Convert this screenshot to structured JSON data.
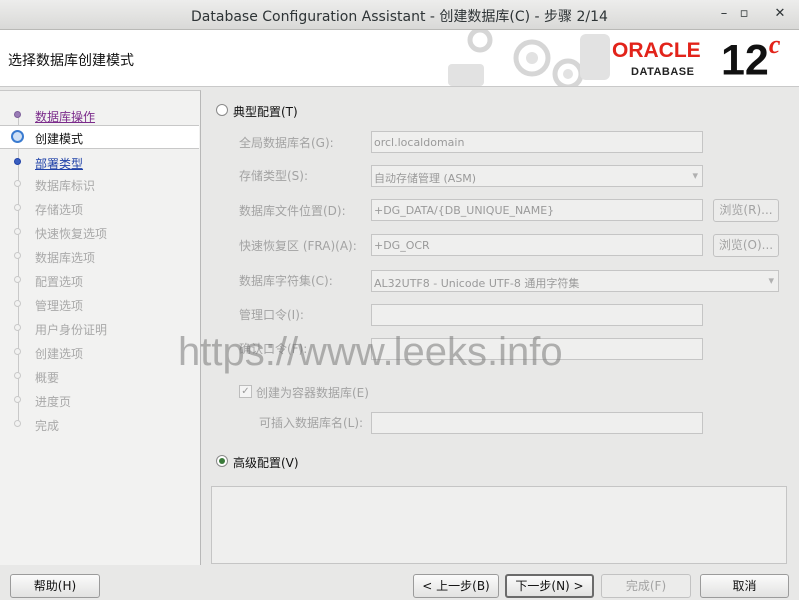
{
  "window": {
    "title": "Database Configuration Assistant - 创建数据库(C) - 步骤 2/14",
    "minimize_icon": "minimize-icon",
    "maximize_icon": "maximize-icon",
    "close_icon": "close-icon"
  },
  "header": {
    "title": "选择数据库创建模式",
    "logo_oracle": "ORACLE",
    "logo_database": "DATABASE",
    "logo_version": "12",
    "logo_version_suffix": "c"
  },
  "nav": {
    "items": [
      {
        "label": "数据库操作",
        "state": "done"
      },
      {
        "label": "创建模式",
        "state": "current"
      },
      {
        "label": "部署类型",
        "state": "link"
      },
      {
        "label": "数据库标识",
        "state": "disabled"
      },
      {
        "label": "存储选项",
        "state": "disabled"
      },
      {
        "label": "快速恢复选项",
        "state": "disabled"
      },
      {
        "label": "数据库选项",
        "state": "disabled"
      },
      {
        "label": "配置选项",
        "state": "disabled"
      },
      {
        "label": "管理选项",
        "state": "disabled"
      },
      {
        "label": "用户身份证明",
        "state": "disabled"
      },
      {
        "label": "创建选项",
        "state": "disabled"
      },
      {
        "label": "概要",
        "state": "disabled"
      },
      {
        "label": "进度页",
        "state": "disabled"
      },
      {
        "label": "完成",
        "state": "disabled"
      }
    ]
  },
  "form": {
    "typical_label": "典型配置(T)",
    "typical_selected": false,
    "global_db_name_label": "全局数据库名(G):",
    "global_db_name_value": "orcl.localdomain",
    "storage_type_label": "存储类型(S):",
    "storage_type_value": "自动存储管理 (ASM)",
    "db_file_location_label": "数据库文件位置(D):",
    "db_file_location_value": "+DG_DATA/{DB_UNIQUE_NAME}",
    "browse_r_label": "浏览(R)...",
    "fra_label": "快速恢复区 (FRA)(A):",
    "fra_value": "+DG_OCR",
    "browse_o_label": "浏览(O)...",
    "charset_label": "数据库字符集(C):",
    "charset_value": "AL32UTF8 - Unicode UTF-8 通用字符集",
    "admin_pwd_label": "管理口令(I):",
    "admin_pwd_value": "",
    "confirm_pwd_label": "确认口令(F):",
    "confirm_pwd_value": "",
    "container_db_label": "创建为容器数据库(E)",
    "container_db_checked": true,
    "pdb_name_label": "可插入数据库名(L):",
    "pdb_name_value": "",
    "advanced_label": "高级配置(V)",
    "advanced_selected": true
  },
  "watermark": "https://www.leeks.info",
  "buttons": {
    "help": "帮助(H)",
    "back": "< 上一步(B)",
    "next": "下一步(N) >",
    "finish": "完成(F)",
    "cancel": "取消"
  },
  "colors": {
    "oracle_red": "#e2231a",
    "selected_radio": "#3a7a3a",
    "link_blue": "#2042a8",
    "visited_purple": "#7b2b8b"
  }
}
